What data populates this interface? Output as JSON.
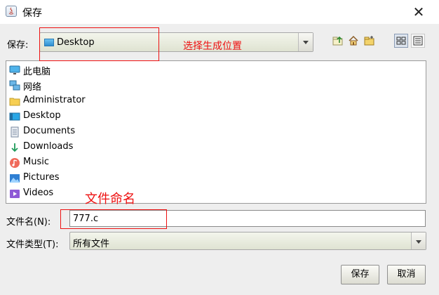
{
  "window": {
    "title": "保存",
    "close_glyph": "✕"
  },
  "lookin": {
    "label": "保存:",
    "value": "Desktop"
  },
  "toolbar": [
    "up-folder-icon",
    "home-icon",
    "new-folder-icon",
    "list-view-icon",
    "details-view-icon"
  ],
  "files": [
    {
      "label": "此电脑",
      "icon": "computer-icon"
    },
    {
      "label": "网络",
      "icon": "network-icon"
    },
    {
      "label": "Administrator",
      "icon": "folder-icon"
    },
    {
      "label": "Desktop",
      "icon": "desktop-icon"
    },
    {
      "label": "Documents",
      "icon": "documents-icon"
    },
    {
      "label": "Downloads",
      "icon": "downloads-icon"
    },
    {
      "label": "Music",
      "icon": "music-icon"
    },
    {
      "label": "Pictures",
      "icon": "pictures-icon"
    },
    {
      "label": "Videos",
      "icon": "videos-icon"
    }
  ],
  "filename": {
    "label": "文件名(N):",
    "value": "777.c"
  },
  "filetype": {
    "label": "文件类型(T):",
    "value": "所有文件"
  },
  "buttons": {
    "save": "保存",
    "cancel": "取消"
  },
  "annotations": {
    "location_note": "选择生成位置",
    "filename_note": "文件命名",
    "color": "#ee1111"
  }
}
